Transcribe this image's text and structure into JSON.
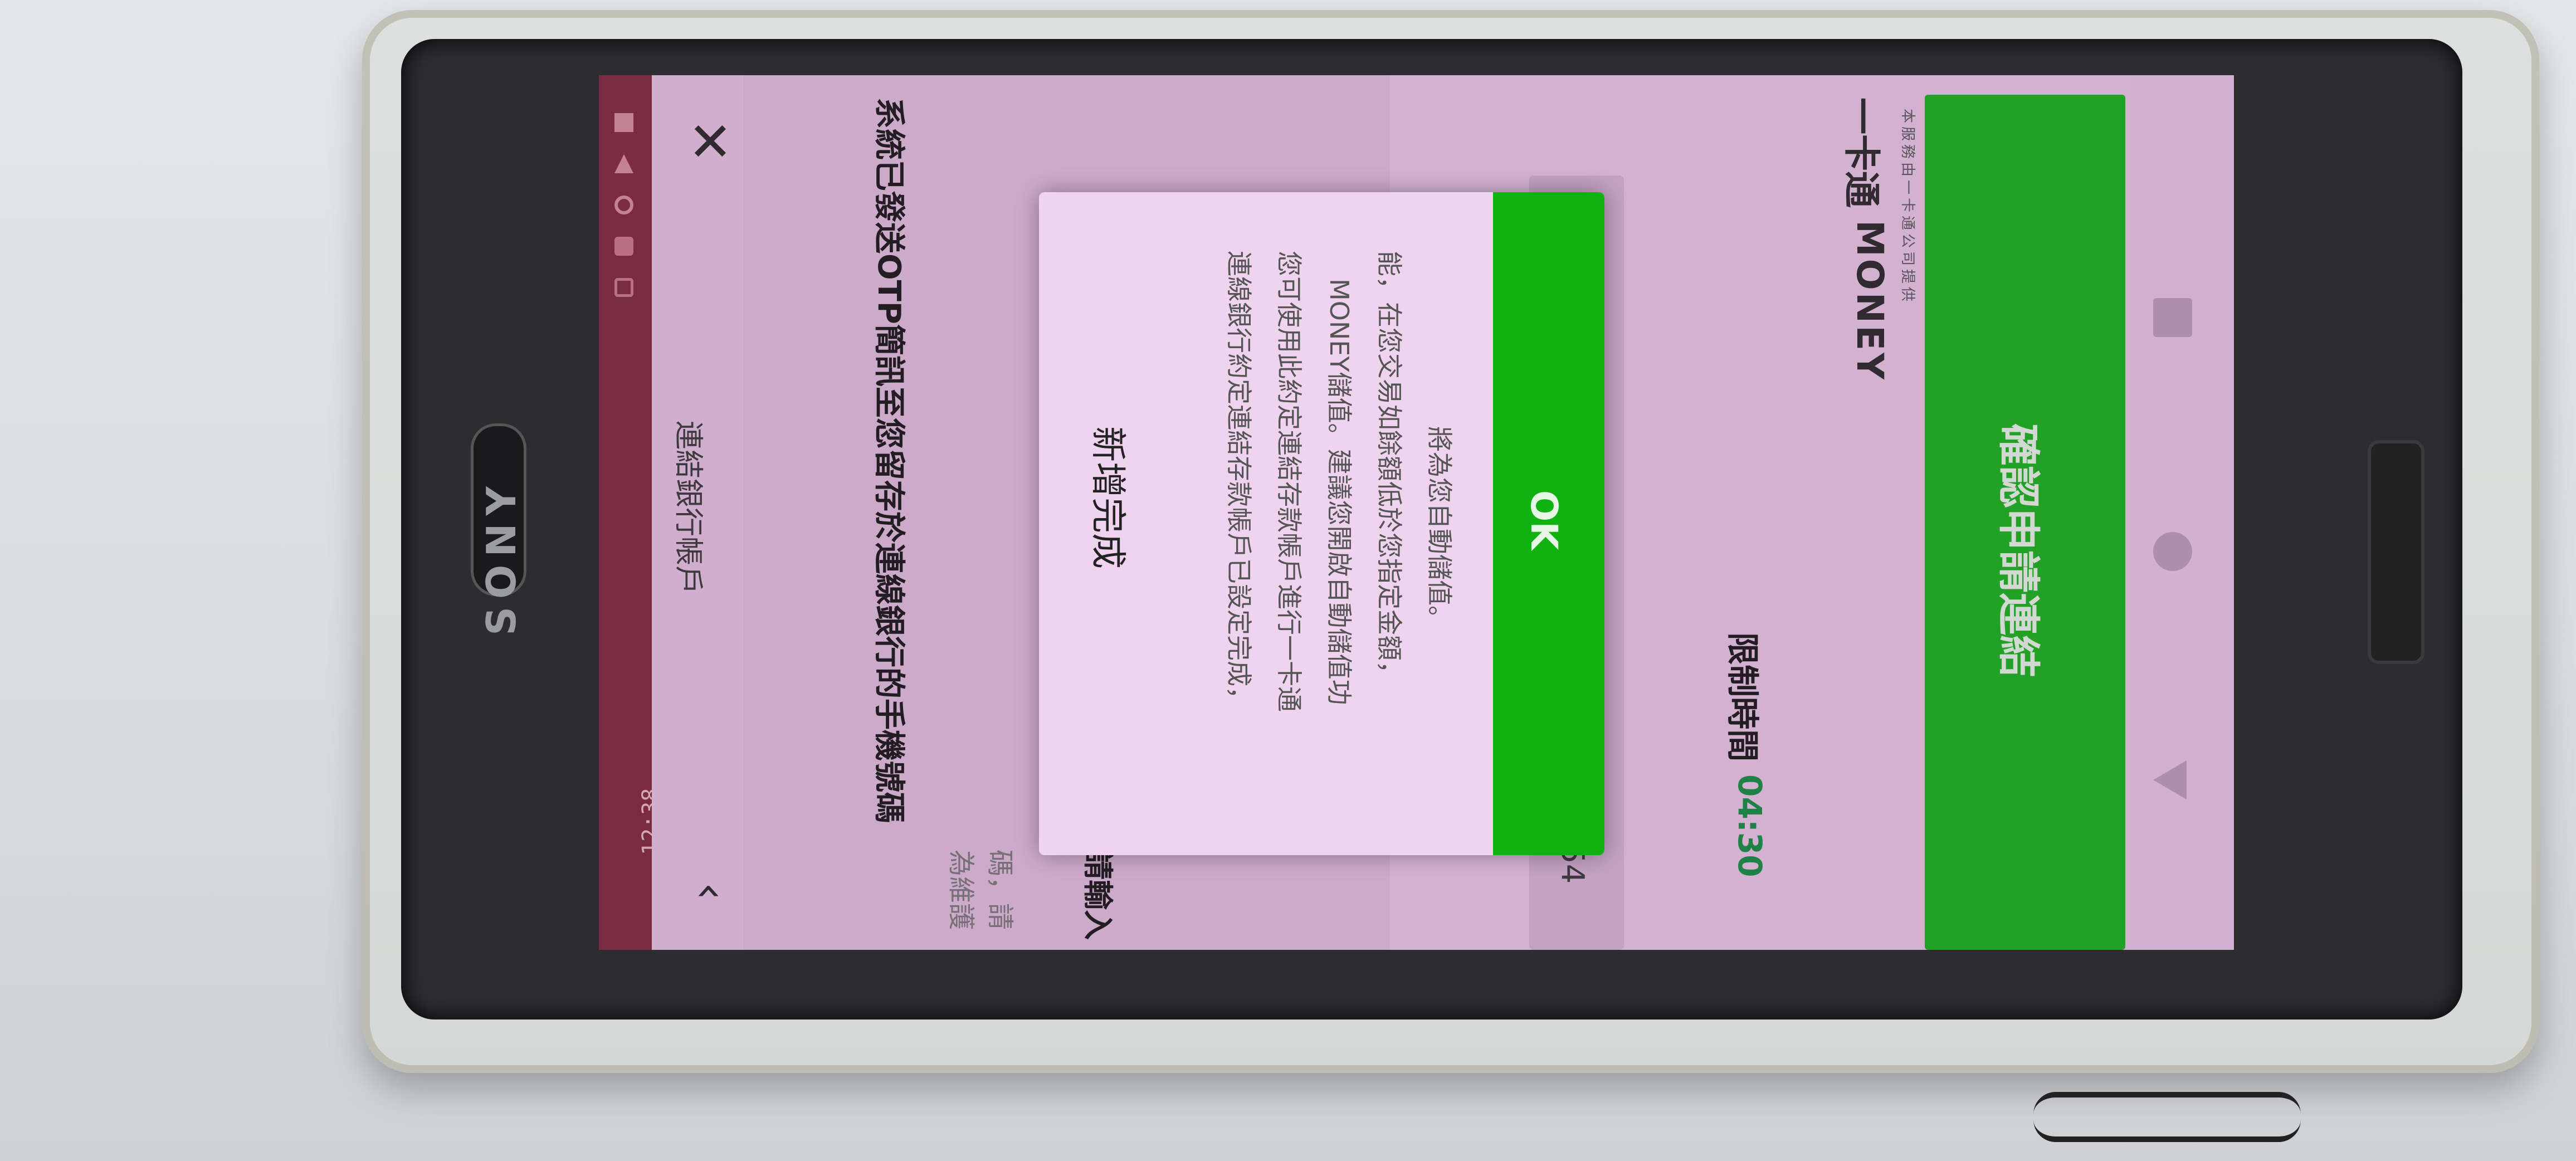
{
  "device": {
    "brand": "SONY"
  },
  "status_bar": {
    "time": "12:38",
    "icons": [
      "message-icon",
      "notification-icon",
      "wifi-icon",
      "signal-icon",
      "battery-icon"
    ]
  },
  "header": {
    "title": "連結銀行帳戶"
  },
  "content": {
    "instruction": "系統已發送OTP簡訊至您留存於連線銀行的手機號碼",
    "note_partial": "為維護",
    "note_partial2": "碼，請",
    "input_label": "請輸入",
    "input_value_partial": "54"
  },
  "timer": {
    "label": "限制時間",
    "value": "04:30"
  },
  "logo": {
    "brand_cn": "一卡通",
    "brand_en": "MONEY",
    "provider": "本服務由一卡通公司提供"
  },
  "confirm_button": {
    "label": "確認申請連結"
  },
  "dialog": {
    "title": "新增完成",
    "lines": [
      "連線銀行約定連結存款帳戶已設定完成，",
      "您可使用此約定連結存款帳戶進行一卡通",
      "MONEY儲值。建議您開啟自動儲值功",
      "能，在您交易如餘額低於您指定金額，",
      "將為您自動儲值。"
    ],
    "ok_label": "OK"
  },
  "colors": {
    "screen_bg": "#e7c6e5",
    "status_bar": "#7a2036",
    "accent_green": "#10b114",
    "timer_green": "#0c8a3a"
  }
}
